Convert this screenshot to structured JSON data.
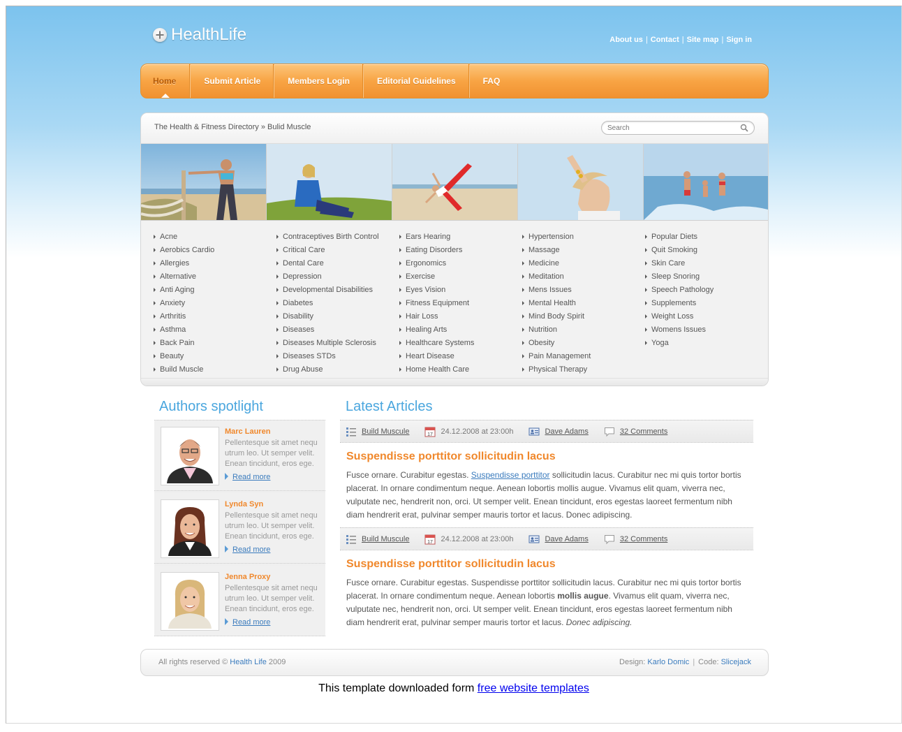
{
  "brand": {
    "name": "HealthLife"
  },
  "top_links": [
    "About us",
    "Contact",
    "Site map",
    "Sign in"
  ],
  "nav": [
    "Home",
    "Submit Article",
    "Members Login",
    "Editorial Guidelines",
    "FAQ"
  ],
  "breadcrumb": {
    "root": "The Health & Fitness Directory",
    "separator": "»",
    "current": "Bulid Muscle"
  },
  "search": {
    "placeholder": "Search"
  },
  "category_columns": [
    [
      "Acne",
      "Aerobics Cardio",
      "Allergies",
      "Alternative",
      "Anti Aging",
      "Anxiety",
      "Arthritis",
      "Asthma",
      "Back Pain",
      "Beauty",
      "Build Muscle"
    ],
    [
      "Contraceptives Birth Control",
      "Critical Care",
      "Dental Care",
      "Depression",
      "Developmental Disabilities",
      "Diabetes",
      "Disability",
      "Diseases",
      "Diseases Multiple Sclerosis",
      "Diseases STDs",
      "Drug Abuse"
    ],
    [
      "Ears Hearing",
      "Eating Disorders",
      "Ergonomics",
      "Exercise",
      "Eyes Vision",
      "Fitness Equipment",
      "Hair Loss",
      "Healing Arts",
      "Healthcare Systems",
      "Heart Disease",
      "Home Health Care"
    ],
    [
      "Hypertension",
      "Massage",
      "Medicine",
      "Meditation",
      "Mens Issues",
      "Mental Health",
      "Mind Body Spirit",
      "Nutrition",
      "Obesity",
      "Pain Management",
      "Physical Therapy"
    ],
    [
      "Popular Diets",
      "Quit Smoking",
      "Skin Care",
      "Sleep Snoring",
      "Speech Pathology",
      "Supplements",
      "Weight Loss",
      "Womens Issues",
      "Yoga"
    ]
  ],
  "authors": {
    "title": "Authors spotlight",
    "items": [
      {
        "name": "Marc Lauren",
        "text": "Pellentesque sit amet nequ utrum leo. Ut semper velit. Enean tincidunt, eros ege.",
        "link": "Read more"
      },
      {
        "name": "Lynda Syn",
        "text": "Pellentesque sit amet nequ utrum leo. Ut semper velit. Enean tincidunt, eros ege.",
        "link": "Read more"
      },
      {
        "name": "Jenna Proxy",
        "text": "Pellentesque sit amet nequ utrum leo. Ut semper velit. Enean tincidunt, eros ege.",
        "link": "Read more"
      }
    ]
  },
  "articles": {
    "title": "Latest Articles",
    "items": [
      {
        "category": "Build Muscule",
        "date": "24.12.2008 at 23:00h",
        "author": "Dave Adams",
        "comments": "32 Comments",
        "title": "Suspendisse porttitor sollicitudin lacus",
        "body_a": "Fusce ornare. Curabitur egestas. ",
        "body_link": "Suspendisse porttitor",
        "body_b": " sollicitudin lacus. Curabitur nec mi quis tortor bortis placerat. In ornare condimentum neque. Aenean lobortis mollis augue. Vivamus elit quam, viverra nec, vulputate nec, hendrerit non, orci. Ut semper velit. Enean tincidunt, eros egestas laoreet fermentum nibh diam hendrerit erat, pulvinar semper mauris tortor et lacus. Donec adipiscing."
      },
      {
        "category": "Build Muscule",
        "date": "24.12.2008 at 23:00h",
        "author": "Dave Adams",
        "comments": "32 Comments",
        "title": "Suspendisse porttitor sollicitudin lacus",
        "body_a": "Fusce ornare. Curabitur egestas. Suspendisse porttitor sollicitudin lacus. Curabitur nec mi quis tortor bortis placerat. In ornare condimentum neque. Aenean lobortis ",
        "body_bold": "mollis augue",
        "body_b": ". Vivamus elit quam, viverra nec, vulputate nec, hendrerit non, orci. Ut semper velit. Enean tincidunt, eros egestas laoreet fermentum nibh diam hendrerit erat, pulvinar semper mauris tortor et lacus. ",
        "body_italic": "Donec adipiscing."
      }
    ]
  },
  "footer": {
    "rights": "All rights reserved ©",
    "rights_link": "Health Life",
    "year": "2009",
    "design_label": "Design:",
    "design_name": "Karlo Domic",
    "code_label": "Code:",
    "code_name": "Slicejack"
  },
  "note": {
    "text": "This template downloaded form ",
    "link": "free website templates"
  },
  "colors": {
    "accent_orange": "#f0882c",
    "title_blue": "#4aa6de",
    "link_blue": "#3a7bbd",
    "nav_orange": "#f8a444"
  }
}
